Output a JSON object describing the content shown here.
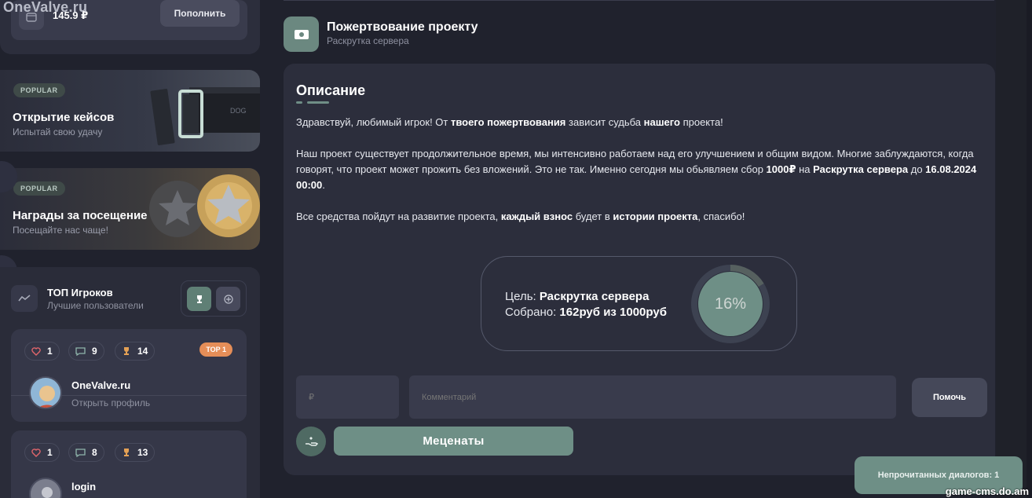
{
  "watermark": {
    "top": "OneValve.ru",
    "bottom": "game-cms.do.am"
  },
  "balance": {
    "value": "145.9 ₽",
    "topup_label": "Пополнить"
  },
  "promos": [
    {
      "badge": "POPULAR",
      "title": "Открытие кейсов",
      "subtitle": "Испытай свою удачу"
    },
    {
      "badge": "POPULAR",
      "title": "Награды за посещение",
      "subtitle": "Посещайте нас чаще!"
    }
  ],
  "top_players": {
    "title": "ТОП Игроков",
    "subtitle": "Лучшие пользователи",
    "players": [
      {
        "likes": "1",
        "comments": "9",
        "trophies": "14",
        "rank": "TOP 1",
        "name": "OneValve.ru",
        "link": "Открыть профиль"
      },
      {
        "likes": "1",
        "comments": "8",
        "trophies": "13",
        "name": "login"
      }
    ]
  },
  "page": {
    "title": "Пожертвование проекту",
    "subtitle": "Раскрутка сервера"
  },
  "description": {
    "title": "Описание",
    "p1_a": "Здравствуй, любимый игрок! От ",
    "p1_b": "твоего пожертвования",
    "p1_c": " зависит судьба ",
    "p1_d": "нашего",
    "p1_e": " проекта!",
    "p2_a": "Наш проект существует продолжительное время, мы интенсивно работаем над его улучшением и общим видом. Многие заблуждаются, когда говорят, что проект может прожить без вложений. Это не так. Именно сегодня мы обьявляем сбор ",
    "p2_b": "1000₽",
    "p2_c": " на ",
    "p2_d": "Раскрутка сервера",
    "p2_e": " до ",
    "p2_f": "16.08.2024 00:00",
    "p2_g": ".",
    "p3_a": "Все средства пойдут на развитие проекта, ",
    "p3_b": "каждый взнос",
    "p3_c": " будет в ",
    "p3_d": "истории проекта",
    "p3_e": ", спасибо!"
  },
  "goal": {
    "goal_label": "Цель: ",
    "goal_value": "Раскрутка сервера",
    "collected_label": "Собрано: ",
    "collected_value": "162руб из 1000руб",
    "percent_label": "16%",
    "progress": 0.162
  },
  "form": {
    "amount_placeholder": "₽",
    "comment_placeholder": "Комментарий",
    "help_label": "Помочь",
    "patrons_label": "Меценаты"
  },
  "notifications": {
    "unread_label": "Непрочитанных диалогов: 1"
  },
  "colors": {
    "accent": "#6e8f86",
    "panel": "#2c2e3c",
    "background": "#20222d",
    "rank_badge": "#e58e58"
  }
}
